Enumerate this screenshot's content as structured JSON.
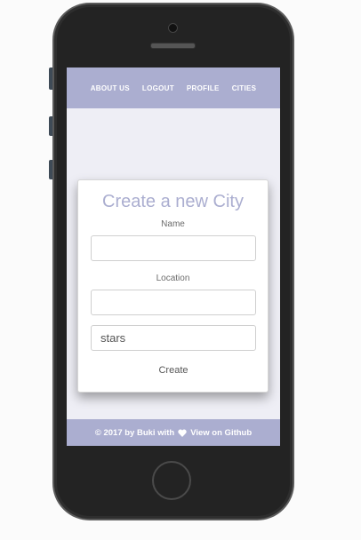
{
  "nav": {
    "items": [
      {
        "label": "ABOUT US"
      },
      {
        "label": "LOGOUT"
      },
      {
        "label": "PROFILE"
      },
      {
        "label": "CITIES"
      }
    ]
  },
  "form": {
    "title": "Create a new City",
    "name_label": "Name",
    "name_value": "",
    "location_label": "Location",
    "location_value": "",
    "stars_placeholder": "stars",
    "create_label": "Create"
  },
  "footer": {
    "copyright": "© 2017 by Buki with",
    "heart_icon": "heart-icon",
    "github_link": "View on Github"
  },
  "colors": {
    "accent": "#abaed0",
    "screen_bg": "#eeeef5",
    "phone_body": "#232323"
  }
}
